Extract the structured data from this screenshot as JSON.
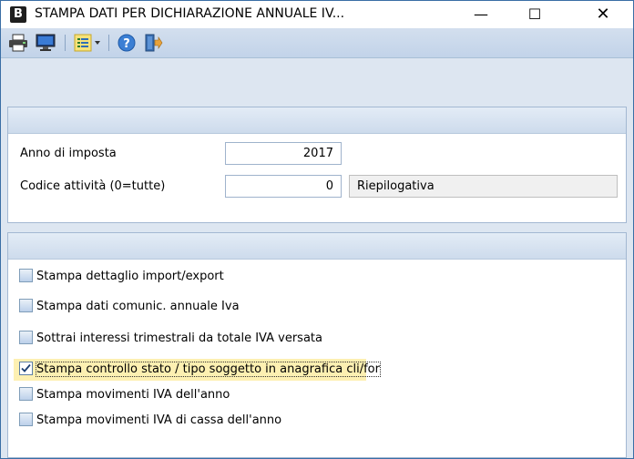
{
  "window": {
    "icon_letter": "B",
    "title": "STAMPA DATI PER DICHIARAZIONE ANNUALE IV...",
    "min": "—",
    "max": "☐",
    "close": "✕"
  },
  "toolbar": {
    "icons": [
      "printer-icon",
      "monitor-icon",
      "options-dropdown-icon",
      "help-icon",
      "exit-icon"
    ]
  },
  "form": {
    "anno_label": "Anno di imposta",
    "anno_value": "2017",
    "codice_label": "Codice attività (0=tutte)",
    "codice_value": "0",
    "codice_desc": "Riepilogativa"
  },
  "options": [
    {
      "label": "Stampa dettaglio import/export",
      "checked": false
    },
    {
      "label": "Stampa dati comunic. annuale Iva",
      "checked": false
    },
    {
      "label": "Sottrai interessi trimestrali da totale IVA versata",
      "checked": false
    },
    {
      "label": "Stampa controllo stato / tipo soggetto in anagrafica cli/for",
      "checked": true
    },
    {
      "label": "Stampa movimenti IVA dell'anno",
      "checked": false
    },
    {
      "label": "Stampa movimenti IVA di cassa dell'anno",
      "checked": false
    }
  ],
  "colors": {
    "accent": "#3a6ea5",
    "panel_header": "#cddbec",
    "highlight": "#fdf0b2"
  }
}
